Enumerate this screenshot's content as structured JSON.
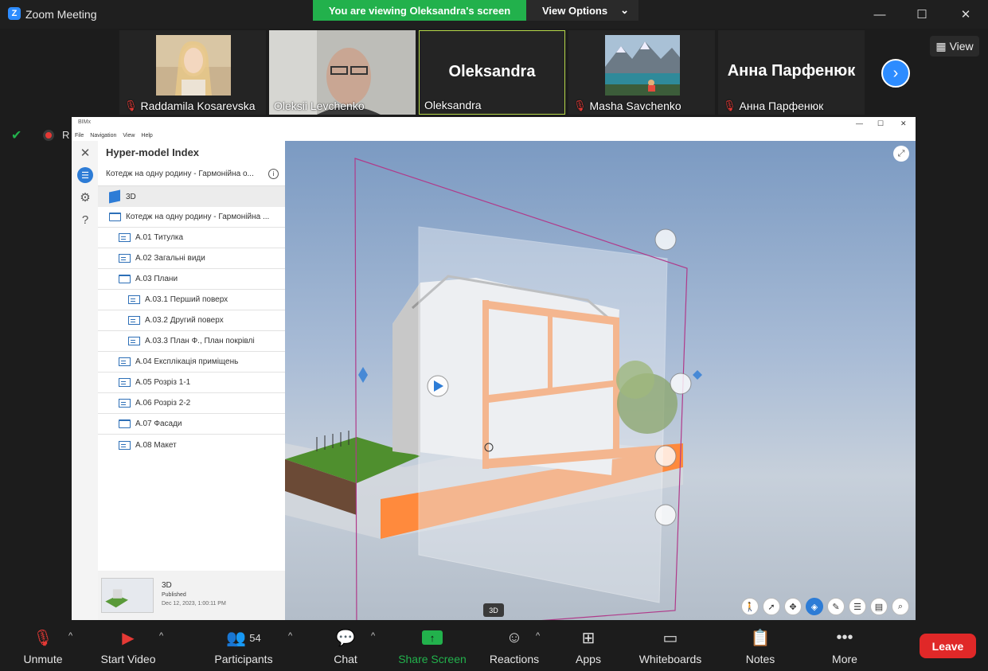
{
  "window": {
    "title": "Zoom Meeting"
  },
  "banner": {
    "viewing": "You are viewing Oleksandra's screen",
    "view_options": "View Options"
  },
  "participants_strip": [
    {
      "name": "Raddamila Kosarevska",
      "muted": true,
      "type": "photo"
    },
    {
      "name": "Oleksii Levchenko",
      "muted": false,
      "type": "video"
    },
    {
      "name": "Oleksandra",
      "muted": false,
      "type": "text",
      "big": "Oleksandra",
      "active": true
    },
    {
      "name": "Masha Savchenko",
      "muted": true,
      "type": "photo"
    },
    {
      "name": "Анна Парфенюк",
      "muted": true,
      "type": "text",
      "big": "Анна Парфенюк"
    }
  ],
  "view_button": "View",
  "recording_label": "R",
  "bimx": {
    "title": "BIMx",
    "menu": [
      "File",
      "Navigation",
      "View",
      "Help"
    ],
    "panel_title": "Hyper-model Index",
    "project_dropdown": "Котедж на одну родину - Гармонійна о...",
    "items": [
      {
        "label": "3D",
        "kind": "3d",
        "level": 0
      },
      {
        "label": "Котедж на одну родину - Гармонійна ...",
        "kind": "folder",
        "level": 0
      },
      {
        "label": "A.01 Титулка",
        "kind": "sheet",
        "level": 1
      },
      {
        "label": "A.02 Загальні види",
        "kind": "sheet",
        "level": 1
      },
      {
        "label": "A.03 Плани",
        "kind": "folder",
        "level": 1
      },
      {
        "label": "A.03.1 Перший поверх",
        "kind": "sheet",
        "level": 2
      },
      {
        "label": "A.03.2 Другий поверх",
        "kind": "sheet",
        "level": 2
      },
      {
        "label": "A.03.3 План Ф., План покрівлі",
        "kind": "sheet",
        "level": 2
      },
      {
        "label": "A.04 Експлікація приміщень",
        "kind": "sheet",
        "level": 1
      },
      {
        "label": "A.05 Розріз 1-1",
        "kind": "sheet",
        "level": 1
      },
      {
        "label": "A.06 Розріз 2-2",
        "kind": "sheet",
        "level": 1
      },
      {
        "label": "A.07 Фасади",
        "kind": "folder",
        "level": 1
      },
      {
        "label": "A.08 Макет",
        "kind": "sheet",
        "level": 1
      }
    ],
    "footer": {
      "title": "3D",
      "status": "Published",
      "date": "Dec 12, 2023, 1:00:11 PM"
    },
    "viewport_tag": "3D"
  },
  "bottombar": {
    "unmute": "Unmute",
    "start_video": "Start Video",
    "participants": "Participants",
    "participants_count": "54",
    "chat": "Chat",
    "share_screen": "Share Screen",
    "reactions": "Reactions",
    "apps": "Apps",
    "whiteboards": "Whiteboards",
    "notes": "Notes",
    "more": "More",
    "leave": "Leave"
  },
  "colors": {
    "zoom_blue": "#2d8cff",
    "share_green": "#22b14c",
    "leave_red": "#e02828",
    "bimx_blue": "#2d7cd6",
    "section_orange": "#ff8a4c"
  }
}
